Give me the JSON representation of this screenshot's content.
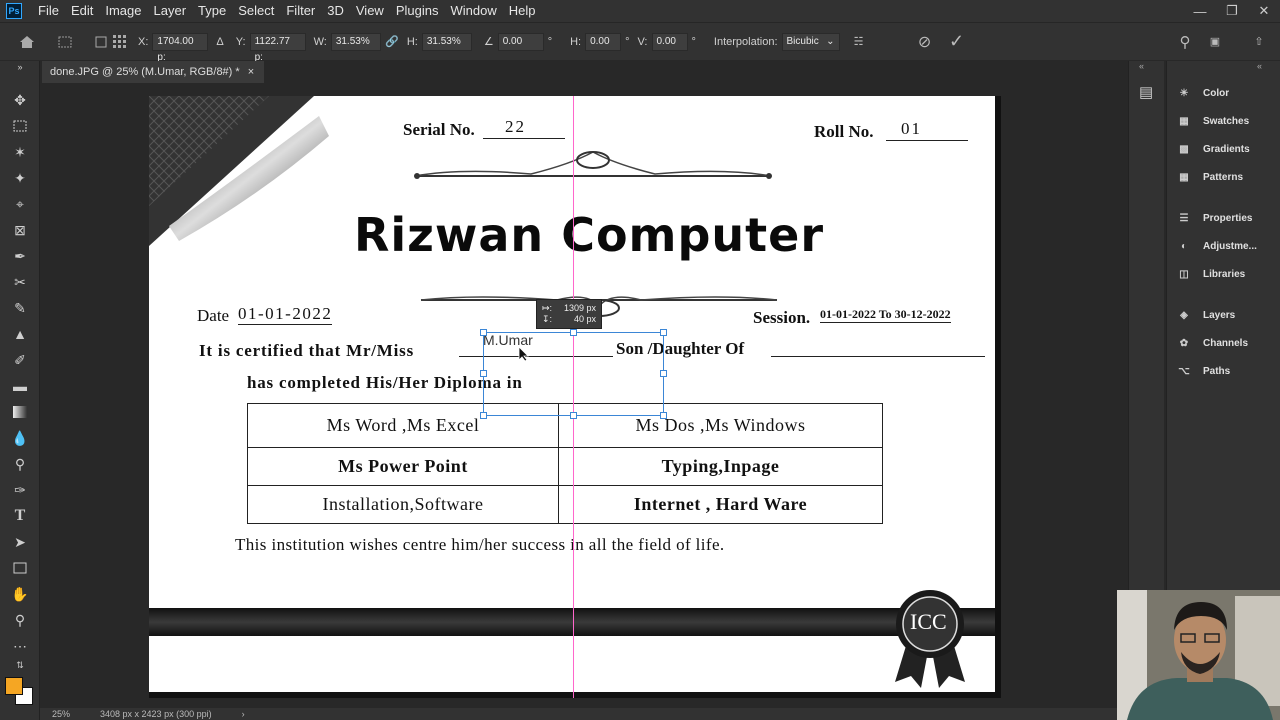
{
  "app": {
    "logo": "Ps",
    "menu": [
      "File",
      "Edit",
      "Image",
      "Layer",
      "Type",
      "Select",
      "Filter",
      "3D",
      "View",
      "Plugins",
      "Window",
      "Help"
    ]
  },
  "options": {
    "x_label": "X:",
    "x_value": "1704.00 p:",
    "y_label": "Y:",
    "y_value": "1122.77 p:",
    "w_label": "W:",
    "w_value": "31.53%",
    "h_label": "H:",
    "h_value": "31.53%",
    "angle_value": "0.00",
    "angle_unit": "°",
    "hskew_label": "H:",
    "hskew_value": "0.00",
    "hskew_unit": "°",
    "vskew_label": "V:",
    "vskew_value": "0.00",
    "vskew_unit": "°",
    "interp_label": "Interpolation:",
    "interp_value": "Bicubic"
  },
  "tab": {
    "title": "done.JPG @ 25% (M.Umar, RGB/8#) *",
    "close": "×"
  },
  "status": {
    "zoom": "25%",
    "doc_size": "3408 px x 2423 px (300 ppi)",
    "arrow": "›"
  },
  "certificate": {
    "serial_label": "Serial No.",
    "serial_value": "22",
    "roll_label": "Roll No.",
    "roll_value": "01",
    "title": "Rizwan Computer",
    "date_label": "Date",
    "date_value": "01-01-2022",
    "session_label": "Session.",
    "session_value": "01-01-2022 To 30-12-2022",
    "certify_text": "It is certified that Mr/Miss",
    "name_value": "M.Umar",
    "son_text": "Son /Daughter Of",
    "completed_text": "has completed His/Her Diploma in",
    "subjects": [
      [
        "Ms Word ,Ms Excel",
        "Ms Dos ,Ms Windows"
      ],
      [
        "Ms Power Point",
        "Typing,Inpage"
      ],
      [
        "Installation,Software",
        "Internet , Hard Ware"
      ]
    ],
    "footer_text": "This institution wishes centre him/her success in all the field of life.",
    "seal_text": "ICC"
  },
  "measure_tooltip": {
    "w": "1309 px",
    "h": "40 px"
  },
  "panels": {
    "group1": [
      "Color",
      "Swatches",
      "Gradients",
      "Patterns"
    ],
    "group2": [
      "Properties",
      "Adjustme...",
      "Libraries"
    ],
    "group3": [
      "Layers",
      "Channels",
      "Paths"
    ]
  },
  "colors": {
    "foreground": "#f5a623",
    "background": "#ffffff",
    "guide": "#ff66cc",
    "selection": "#3b86d6"
  }
}
